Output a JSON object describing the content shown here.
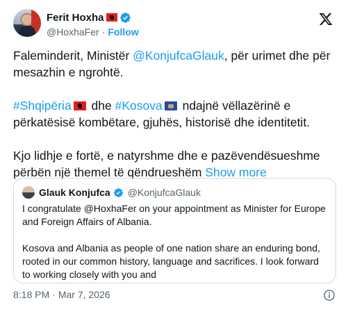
{
  "author": {
    "display_name": "Ferit Hoxha",
    "handle": "@HoxhaFer",
    "separator": "·",
    "follow_label": "Follow"
  },
  "tweet": {
    "p1_pre": "Faleminderit, Ministër ",
    "p1_mention": "@KonjufcaGlauk",
    "p1_post": ", për urimet dhe për mesazhin e ngrohtë.",
    "p2_hashtag1": "#Shqipëria",
    "p2_mid": " dhe ",
    "p2_hashtag2": "#Kosova",
    "p2_post": " ndajnë vëllazërinë e përkatësisë kombëtare, gjuhës, historisë dhe identitetit.",
    "p3_text": "Kjo lidhje e fortë, e natyrshme dhe e pazëvendësueshme përbën një themel të qëndrueshëm ",
    "show_more_label": "Show more"
  },
  "quote": {
    "display_name": "Glauk Konjufca",
    "handle": "@KonjufcaGlauk",
    "p1": "I congratulate @HoxhaFer on your appointment as Minister for Europe and Foreign Affairs of Albania.",
    "p2": "Kosova and Albania as people of one nation share an enduring bond, rooted in our common history, language and sacrifices. I look forward to working closely with you and"
  },
  "footer": {
    "time": "8:18 PM",
    "separator": "·",
    "date": "Mar 7, 2026"
  },
  "colors": {
    "accent": "#1d9bf0",
    "text": "#0f1419",
    "muted": "#536471",
    "border": "#cfd9de"
  },
  "icons": {
    "verified": "verified-badge-icon",
    "platform": "x-logo-icon",
    "info": "info-icon",
    "flag_al": "albania-flag-icon",
    "flag_xk": "kosovo-flag-icon"
  }
}
